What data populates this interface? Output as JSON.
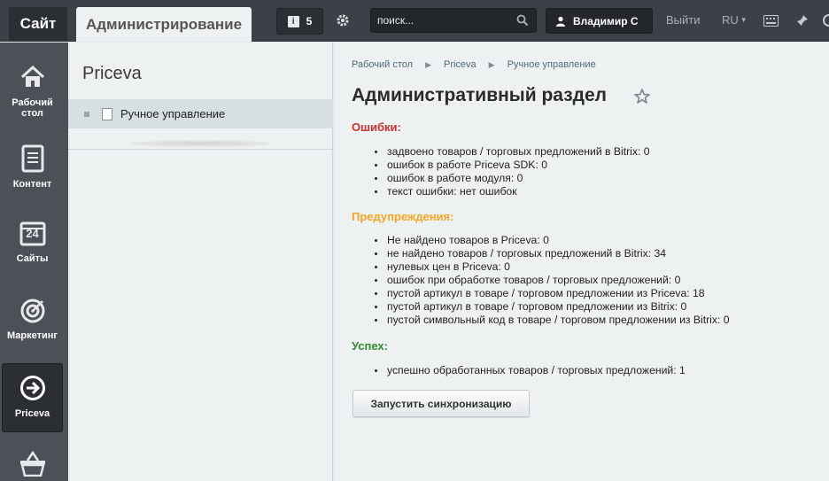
{
  "topbar": {
    "site_label": "Сайт",
    "admin_tab": "Администрирование",
    "notifications_count": "5",
    "search_placeholder": "поиск...",
    "user_name": "Владимир С",
    "logout_label": "Выйти",
    "language": "RU"
  },
  "leftmenu": {
    "items": [
      {
        "label": "Рабочий стол",
        "icon": "home-icon"
      },
      {
        "label": "Контент",
        "icon": "document-icon"
      },
      {
        "label": "Сайты",
        "icon": "calendar-icon",
        "badge": "24"
      },
      {
        "label": "Маркетинг",
        "icon": "target-icon"
      },
      {
        "label": "Priceva",
        "icon": "arrow-circle-icon",
        "active": true
      },
      {
        "label": "",
        "icon": "basket-icon"
      }
    ]
  },
  "tree": {
    "title": "Priceva",
    "items": [
      {
        "label": "Ручное управление"
      }
    ]
  },
  "breadcrumb": [
    "Рабочий стол",
    "Priceva",
    "Ручное управление"
  ],
  "page": {
    "title": "Административный раздел",
    "errors": {
      "heading": "Ошибки:",
      "items": [
        "задвоено товаров / торговых предложений в Bitrix: 0",
        "ошибок в работе Priceva SDK: 0",
        "ошибок в работе модуля: 0",
        "текст ошибки: нет ошибок"
      ]
    },
    "warnings": {
      "heading": "Предупреждения:",
      "items": [
        "Не найдено товаров в Priceva: 0",
        "не найдено товаров / торговых предложений в Bitrix: 34",
        "нулевых цен в Priceva: 0",
        "ошибок при обработке товаров / торговых предложений: 0",
        "пустой артикул в товаре / торговом предложении из Priceva: 18",
        "пустой артикул в товаре / торговом предложении из Bitrix: 0",
        "пустой символьный код в товаре / торговом предложении из Bitrix: 0"
      ]
    },
    "success": {
      "heading": "Успех:",
      "items": [
        "успешно обработанных товаров / торговых предложений: 1"
      ]
    },
    "sync_button": "Запустить синхронизацию"
  },
  "colors": {
    "error": "#d32f2f",
    "warning": "#f5a623",
    "success": "#2e8b2e",
    "topbar": "#3b4146",
    "leftmenu": "#4b5157"
  }
}
